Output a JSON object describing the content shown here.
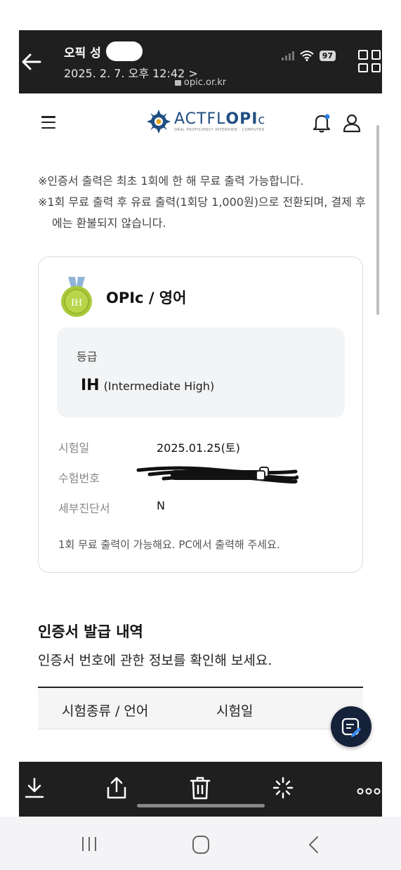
{
  "viewer": {
    "title": "오픽 성",
    "date": "2025. 2. 7. 오후 12:42 >",
    "battery": "97",
    "url": "opic.or.kr"
  },
  "header": {
    "logo_main": "ACTFL",
    "logo_opic": "OPI",
    "logo_c": "c",
    "logo_sub": "ORAL PROFICIENCY INTERVIEW · COMPUTER"
  },
  "notice": {
    "line1": "※인증서 출력은 최초 1회에 한 해 무료 출력 가능합니다.",
    "line2": "※1회 무료 출력 후 유료 출력(1회당 1,000원)으로 전환되며, 결제 후에는 환불되지 않습니다."
  },
  "card": {
    "medal_text": "IH",
    "title": "OPIc / 영어",
    "grade_label": "등급",
    "grade_code": "IH",
    "grade_desc": "(Intermediate High)",
    "rows": [
      {
        "key": "시험일",
        "value": "2025.01.25(토)"
      },
      {
        "key": "수험번호",
        "value": ""
      },
      {
        "key": "세부진단서",
        "value": "N"
      }
    ],
    "footer": "1회 무료 출력이 가능해요. PC에서 출력해 주세요."
  },
  "history": {
    "title": "인증서 발급 내역",
    "subtitle": "인증서 번호에 관한 정보를 확인해 보세요.",
    "columns": [
      "시험종류 / 언어",
      "시험일"
    ]
  },
  "colors": {
    "brand_navy": "#1f4e82",
    "medal_green": "#a8c93a",
    "viewer_bg": "#1f1f1f",
    "fab_bg": "#16213a"
  }
}
